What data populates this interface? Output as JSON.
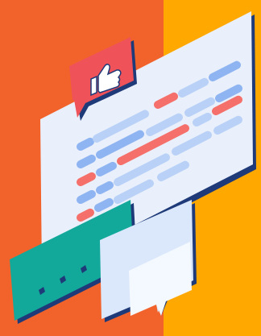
{
  "illustration": {
    "icons": [
      "thumbs-up-icon",
      "speech-bubble-icon",
      "ellipsis-dots-icon"
    ],
    "colors": {
      "background_left": "#f2632c",
      "background_right": "#ffa800",
      "panel_fill": "#e9f0fb",
      "panel_outline": "#1f3a78",
      "bar_blue": "#8fb4f2",
      "bar_light_blue": "#b9d1f7",
      "bar_red": "#f5706a",
      "thumbs_badge": "#f0525a",
      "chat_bubble_teal": "#12a89a",
      "chat_bubble_light": "#dbe8fb"
    }
  }
}
